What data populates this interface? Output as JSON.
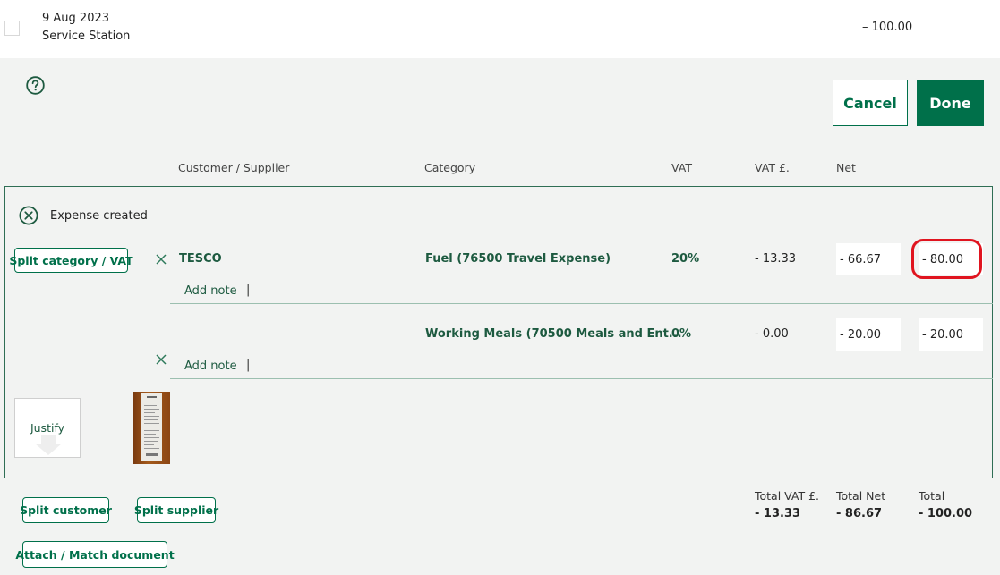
{
  "transaction": {
    "date": "9 Aug 2023",
    "merchant": "Service Station",
    "amount": "– 100.00"
  },
  "actions": {
    "cancel_label": "Cancel",
    "done_label": "Done"
  },
  "columns": {
    "customer_supplier": "Customer / Supplier",
    "category": "Category",
    "vat": "VAT",
    "vat_amount": "VAT £.",
    "net": "Net"
  },
  "status": {
    "text": "Expense created"
  },
  "split_category_label": "Split category / VAT",
  "lines": [
    {
      "supplier": "TESCO",
      "category": "Fuel (76500 Travel Expense)",
      "vat_rate": "20%",
      "vat_amount": "- 13.33",
      "net": "- 66.67",
      "total": "- 80.00",
      "add_note": "Add note"
    },
    {
      "supplier": "",
      "category": "Working Meals (70500 Meals and Ent...",
      "vat_rate": "0%",
      "vat_amount": "- 0.00",
      "net": "- 20.00",
      "total": "- 20.00",
      "add_note": "Add note"
    }
  ],
  "justify_label": "Justify",
  "buttons": {
    "split_customer": "Split customer",
    "split_supplier": "Split supplier",
    "attach_match": "Attach / Match document"
  },
  "totals": {
    "vat_label": "Total VAT £.",
    "vat_value": "- 13.33",
    "net_label": "Total Net",
    "net_value": "- 86.67",
    "total_label": "Total",
    "total_value": "- 100.00"
  },
  "colors": {
    "brand_green": "#00704a",
    "highlight_red": "#e0141f",
    "background": "#f2f3f2"
  },
  "icons": [
    "help-icon",
    "status-cancel-icon",
    "remove-line-icon",
    "receipt-thumbnail"
  ]
}
